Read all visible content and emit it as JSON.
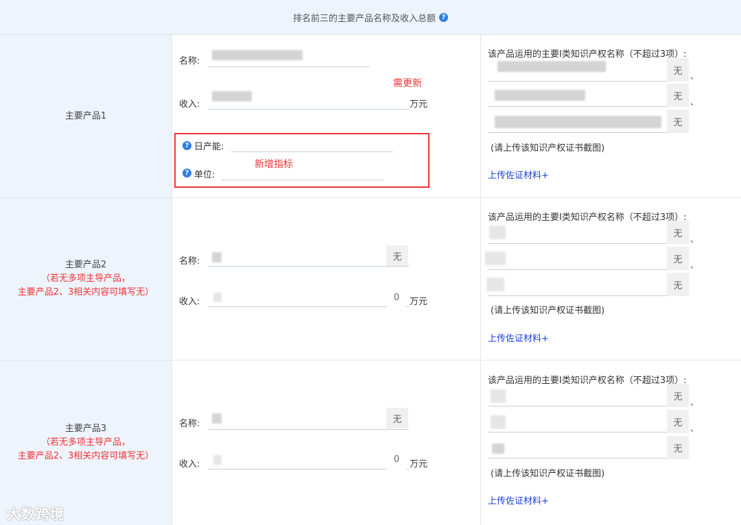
{
  "header": {
    "title": "排名前三的主要产品名称及收入总额",
    "help_icon": "question-circle-icon"
  },
  "labels": {
    "name": "名称:",
    "income": "收入:",
    "unit_wan": "万元",
    "daily_capacity": "日产能:",
    "unit_field": "单位:",
    "ip_title": "该产品运用的主要I类知识产权名称（不超过3项）:",
    "none": "无",
    "comma": "、",
    "upload_note": "(请上传该知识产权证书截图)",
    "upload_link": "上传佐证材料+"
  },
  "annotations": {
    "needs_update": "需更新",
    "new_indicator": "新增指标"
  },
  "products": [
    {
      "title": "主要产品1",
      "note_line1": "",
      "note_line2": "",
      "income_value": "",
      "name_addon": ""
    },
    {
      "title": "主要产品2",
      "note_line1": "（若无多项主导产品，",
      "note_line2": "主要产品2、3相关内容可填写无）",
      "income_value": "0",
      "name_addon": "无"
    },
    {
      "title": "主要产品3",
      "note_line1": "（若无多项主导产品，",
      "note_line2": "主要产品2、3相关内容可填写无）",
      "income_value": "0",
      "name_addon": "无"
    }
  ],
  "watermark": "大数跨境",
  "colors": {
    "header_bg": "#eef4fc",
    "accent_red": "#e33333",
    "link_blue": "#1a3fcf",
    "help_blue": "#2f7ee6"
  }
}
